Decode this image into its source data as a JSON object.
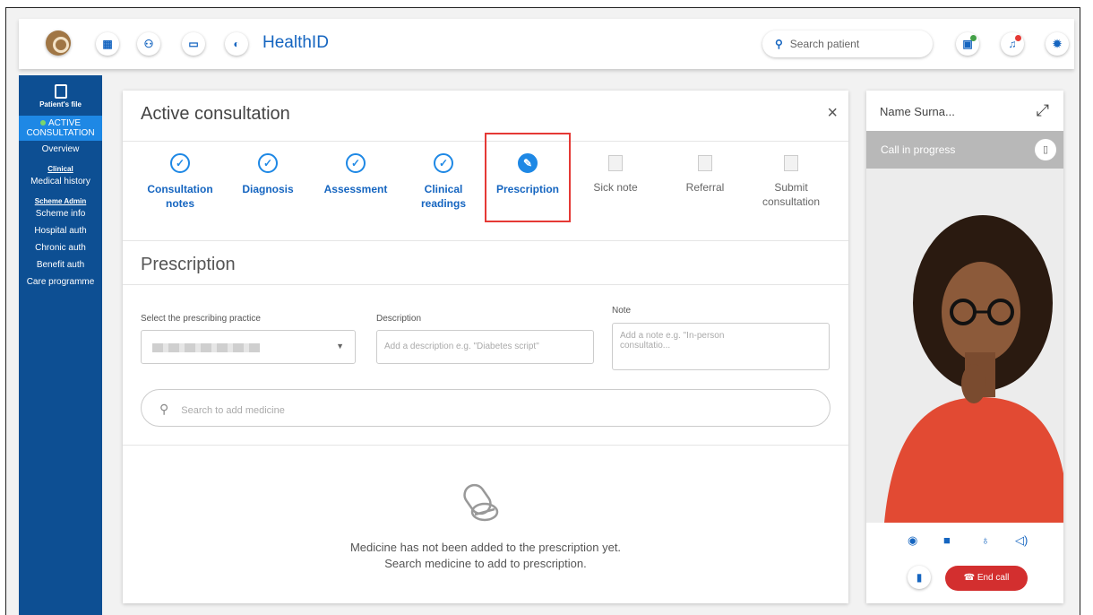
{
  "header": {
    "app_title": "HealthID",
    "search_placeholder": "Search patient",
    "icons": [
      "logo-icon",
      "calendar-icon",
      "group-icon",
      "card-icon",
      "bag-icon",
      "clipboard-icon",
      "bell-icon",
      "settings-icon"
    ]
  },
  "sidebar": {
    "patients_file": "Patient's file",
    "active_line1": "ACTIVE",
    "active_line2": "CONSULTATION",
    "overview": "Overview",
    "clinical_head": "Clinical",
    "medical_history": "Medical history",
    "scheme_head": "Scheme Admin",
    "items": [
      "Scheme info",
      "Hospital auth",
      "Chronic auth",
      "Benefit auth",
      "Care programme"
    ]
  },
  "consultation": {
    "title": "Active consultation",
    "close": "×",
    "steps": [
      {
        "l1": "Consultation",
        "l2": "notes",
        "state": "done"
      },
      {
        "l1": "Diagnosis",
        "l2": "",
        "state": "done"
      },
      {
        "l1": "Assessment",
        "l2": "",
        "state": "done"
      },
      {
        "l1": "Clinical",
        "l2": "readings",
        "state": "done"
      },
      {
        "l1": "Prescription",
        "l2": "",
        "state": "current"
      },
      {
        "l1": "Sick note",
        "l2": "",
        "state": "pending"
      },
      {
        "l1": "Referral",
        "l2": "",
        "state": "pending"
      },
      {
        "l1": "Submit",
        "l2": "consultation",
        "state": "pending"
      }
    ],
    "section_title": "Prescription",
    "practice_label": "Select the prescribing practice",
    "description_label": "Description",
    "description_placeholder": "Add a description e.g. \"Diabetes script\"",
    "note_label": "Note",
    "note_placeholder_1": "Add a note e.g. \"In-person",
    "note_placeholder_2": "consultatio...",
    "medicine_search_placeholder": "Search to add medicine",
    "empty_line1": "Medicine has not been added to the prescription yet.",
    "empty_line2": "Search medicine to add to prescription."
  },
  "video": {
    "name": "Name Surna...",
    "status": "Call in progress",
    "end_call": "End call"
  },
  "colors": {
    "primary": "#1565c0",
    "accent": "#1e88e5",
    "sidebar": "#0d4f93",
    "danger": "#d32f2f",
    "highlight": "#e53935"
  }
}
